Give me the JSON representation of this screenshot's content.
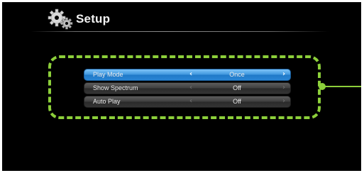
{
  "header": {
    "title": "Setup",
    "icon": "gear-icon"
  },
  "menu": {
    "items": [
      {
        "label": "Play Mode",
        "value": "Once",
        "active": true
      },
      {
        "label": "Show Spectrum",
        "value": "Off",
        "active": false
      },
      {
        "label": "Auto Play",
        "value": "Off",
        "active": false
      }
    ]
  },
  "arrows": {
    "left": "‹",
    "right": "›"
  },
  "colors": {
    "background": "#000000",
    "highlight": "#8ccf3a",
    "active_row": "#2a86d4",
    "inactive_row": "#3e3e3e",
    "text": "#eaeaea"
  }
}
